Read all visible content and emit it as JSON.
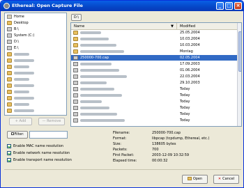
{
  "title": "Ethereal: Open Capture File",
  "path_button": "D:\\",
  "places": [
    {
      "label": "Home",
      "icon": "home"
    },
    {
      "label": "Desktop",
      "icon": "folder"
    },
    {
      "label": "B:\\",
      "icon": "drive"
    },
    {
      "label": "System (C:)",
      "icon": "drive"
    },
    {
      "label": "D:\\",
      "icon": "drive"
    },
    {
      "label": "E:\\",
      "icon": "drive"
    },
    {
      "label": "",
      "icon": "folder"
    },
    {
      "label": "",
      "icon": "folder"
    },
    {
      "label": "",
      "icon": "folder"
    },
    {
      "label": "",
      "icon": "folder"
    },
    {
      "label": "",
      "icon": "folder"
    },
    {
      "label": "",
      "icon": "folder"
    },
    {
      "label": "",
      "icon": "folder"
    },
    {
      "label": "",
      "icon": "folder"
    },
    {
      "label": "",
      "icon": "folder"
    },
    {
      "label": "",
      "icon": "folder"
    }
  ],
  "add_label": "Add",
  "remove_label": "Remove",
  "columns": {
    "name": "Name",
    "modified": "Modified"
  },
  "files": [
    {
      "name": "",
      "modified": "25.05.2004"
    },
    {
      "name": "",
      "modified": "10.03.2004"
    },
    {
      "name": "",
      "modified": "10.03.2004"
    },
    {
      "name": "",
      "modified": "Montag"
    },
    {
      "name": "250000-700.cap",
      "modified": "02.05.2004",
      "selected": true
    },
    {
      "name": "",
      "modified": "17.09.2003"
    },
    {
      "name": "",
      "modified": "01.06.2004"
    },
    {
      "name": "",
      "modified": "22.03.2004"
    },
    {
      "name": "",
      "modified": "29.10.2003"
    },
    {
      "name": "",
      "modified": "Today"
    },
    {
      "name": "",
      "modified": "Today"
    },
    {
      "name": "",
      "modified": "Today"
    },
    {
      "name": "",
      "modified": "Today"
    },
    {
      "name": "",
      "modified": "Today"
    },
    {
      "name": "",
      "modified": "Today"
    }
  ],
  "filter_label": "Filter:",
  "filter_value": "",
  "options": [
    "Enable MAC name resolution",
    "Enable network name resolution",
    "Enable transport name resolution"
  ],
  "info": [
    {
      "label": "Filename:",
      "value": "250000-700.cap"
    },
    {
      "label": "Format:",
      "value": "libpcap (tcpdump, Ethereal, etc.)"
    },
    {
      "label": "Size:",
      "value": "138605 bytes"
    },
    {
      "label": "Packets:",
      "value": "700"
    },
    {
      "label": "First Packet:",
      "value": "2003-12-09 10:32:59"
    },
    {
      "label": "Elapsed time:",
      "value": "00:00:32"
    }
  ],
  "open_label": "Open",
  "cancel_label": "Cancel"
}
